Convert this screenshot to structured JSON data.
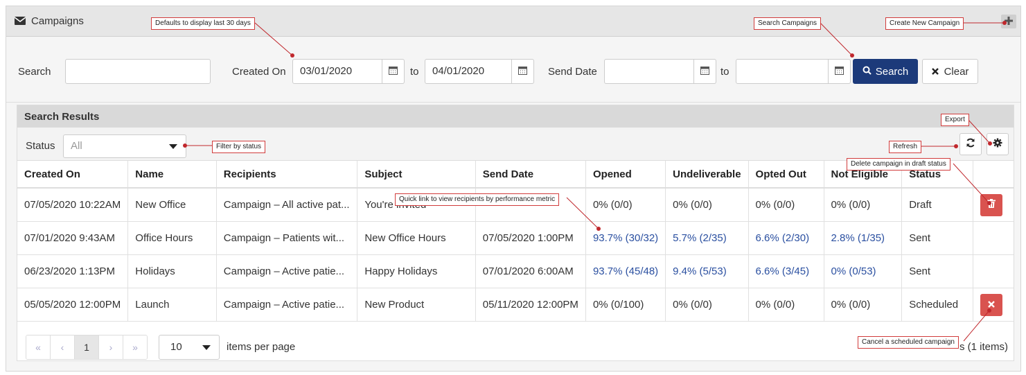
{
  "header": {
    "title": "Campaigns"
  },
  "search": {
    "search_label": "Search",
    "search_value": "",
    "created_on_label": "Created On",
    "created_from": "03/01/2020",
    "to1": "to",
    "created_to": "04/01/2020",
    "send_date_label": "Send Date",
    "send_from": "",
    "to2": "to",
    "send_to": "",
    "search_button": "Search",
    "clear_button": "Clear"
  },
  "results": {
    "title": "Search Results",
    "status_label": "Status",
    "status_value": "All",
    "columns": [
      "Created On",
      "Name",
      "Recipients",
      "Subject",
      "Send Date",
      "Opened",
      "Undeliverable",
      "Opted Out",
      "Not Eligible",
      "Status",
      ""
    ],
    "rows": [
      {
        "created": "07/05/2020 10:22AM",
        "name": "New Office",
        "recipients": "Campaign – All active pat...",
        "subject": "You're invited",
        "send_date": "",
        "opened": "0% (0/0)",
        "undeliverable": "0% (0/0)",
        "opted_out": "0% (0/0)",
        "not_eligible": "0% (0/0)",
        "status": "Draft",
        "action": "delete"
      },
      {
        "created": "07/01/2020 9:43AM",
        "name": "Office Hours",
        "recipients": "Campaign – Patients wit...",
        "subject": "New Office Hours",
        "send_date": "07/05/2020 1:00PM",
        "opened": "93.7% (30/32)",
        "undeliverable": "5.7% (2/35)",
        "opted_out": "6.6% (2/30)",
        "not_eligible": "2.8% (1/35)",
        "status": "Sent",
        "action": ""
      },
      {
        "created": "06/23/2020 1:13PM",
        "name": "Holidays",
        "recipients": "Campaign – Active patie...",
        "subject": "Happy Holidays",
        "send_date": "07/01/2020 6:00AM",
        "opened": "93.7% (45/48)",
        "undeliverable": "9.4% (5/53)",
        "opted_out": "6.6% (3/45)",
        "not_eligible": "0% (0/53)",
        "status": "Sent",
        "action": ""
      },
      {
        "created": "05/05/2020 12:00PM",
        "name": "Launch",
        "recipients": "Campaign – Active patie...",
        "subject": "New Product",
        "send_date": "05/11/2020 12:00PM",
        "opened": "0% (0/100)",
        "undeliverable": "0% (0/0)",
        "opted_out": "0% (0/0)",
        "not_eligible": "0% (0/0)",
        "status": "Scheduled",
        "action": "cancel"
      }
    ],
    "pager": {
      "first": "«",
      "prev": "‹",
      "page": "1",
      "next": "›",
      "last": "»",
      "per_page": "10",
      "per_page_label": "items per page",
      "count_text": "s (1 items)"
    }
  },
  "callouts": {
    "defaults": "Defaults to display last 30 days",
    "search_campaigns": "Search Campaigns",
    "create_new": "Create New Campaign",
    "export": "Export",
    "refresh": "Refresh",
    "filter_status": "Filter by status",
    "delete_draft": "Delete campaign in draft status",
    "quick_link": "Quick link to view recipients by performance metric",
    "cancel_scheduled": "Cancel a scheduled campaign"
  },
  "colors": {
    "primary": "#1c3a7a",
    "danger": "#d9534f",
    "link": "#2a4fa0",
    "callout_border": "#d13b3b"
  }
}
